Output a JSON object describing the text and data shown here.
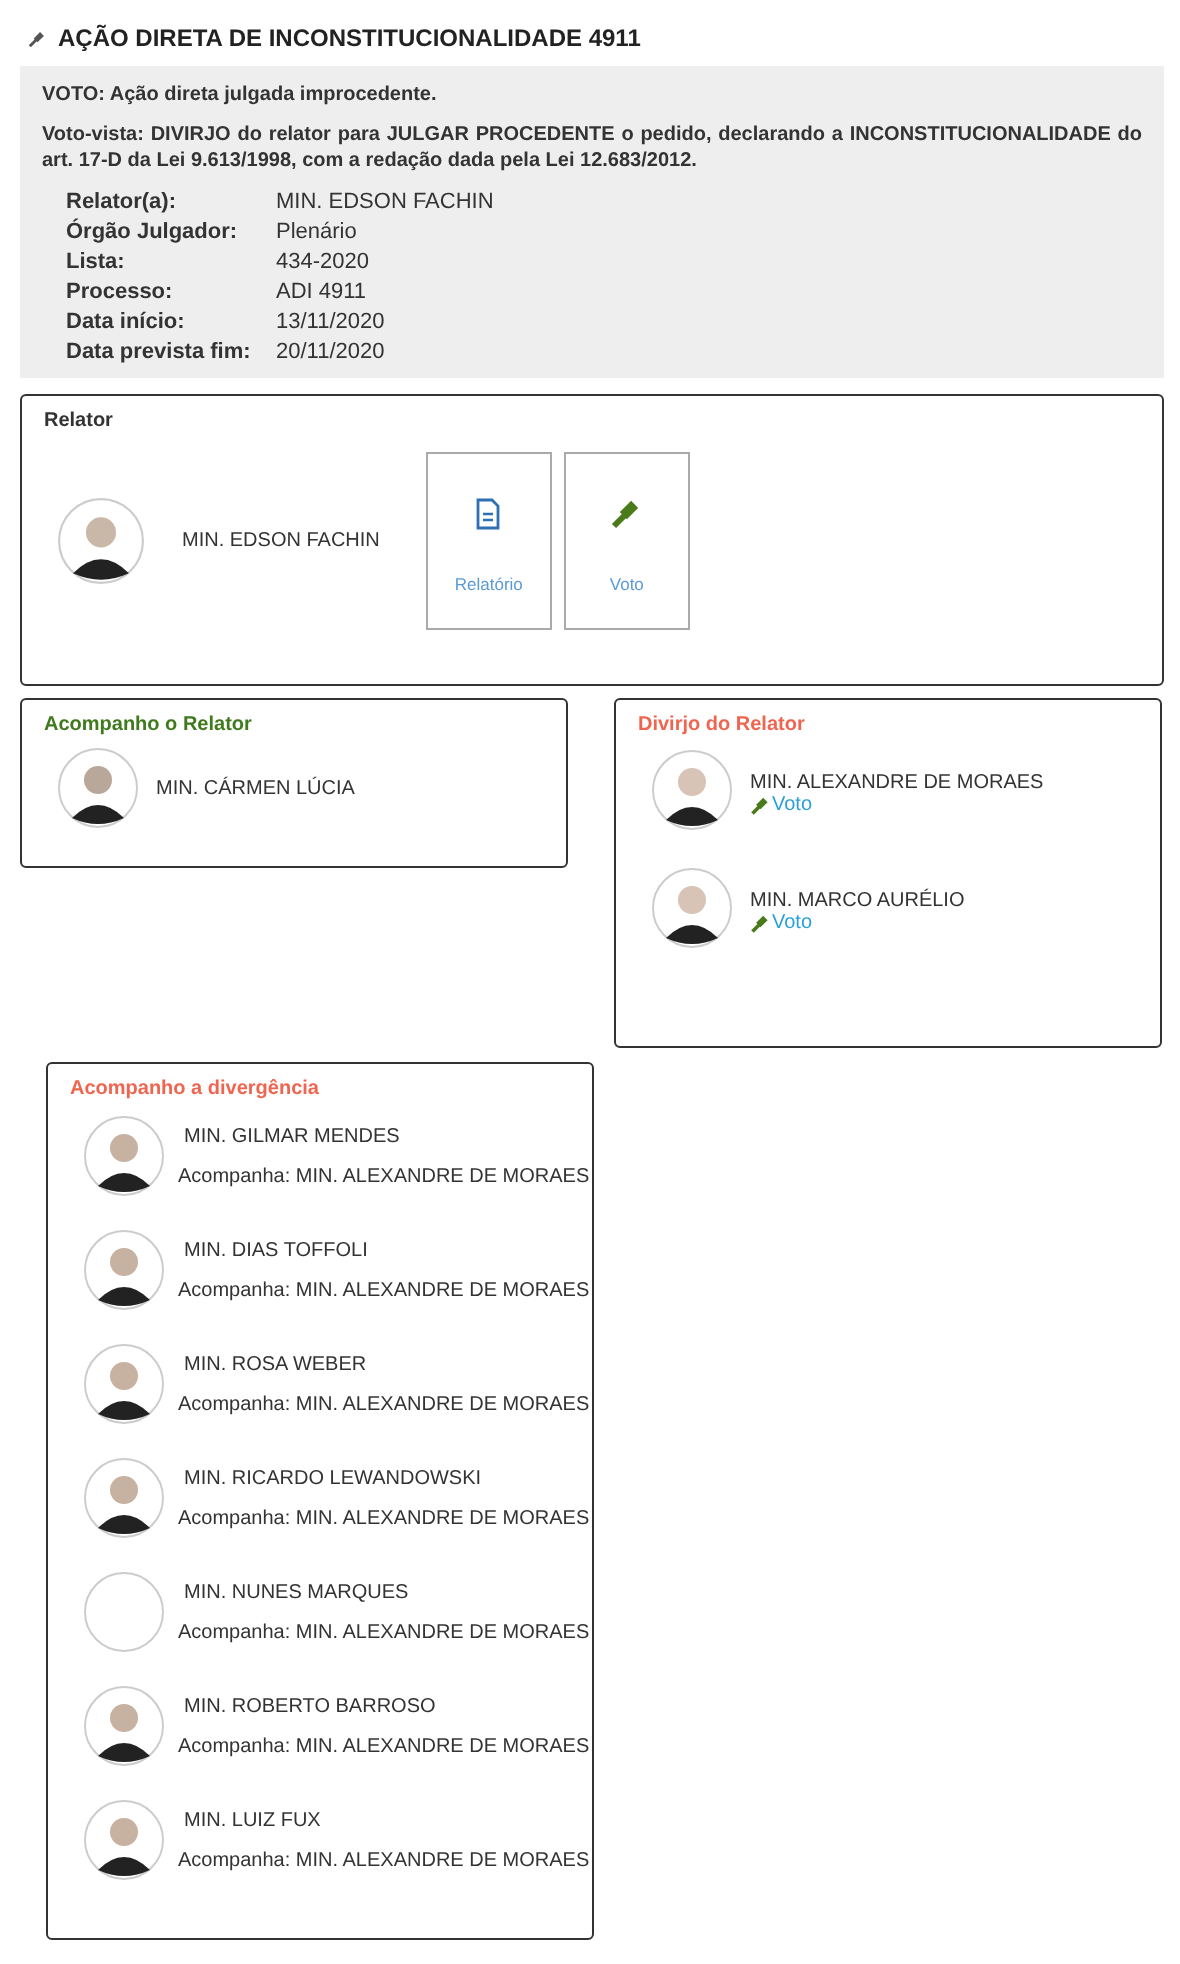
{
  "title": "AÇÃO DIRETA DE INCONSTITUCIONALIDADE 4911",
  "summary": {
    "voto": "VOTO: Ação direta julgada improcedente.",
    "voto_vista": "Voto-vista: DIVIRJO do relator para JULGAR PROCEDENTE o pedido, declarando a INCONSTITUCIONALIDADE do art. 17-D da Lei 9.613/1998, com a redação dada pela Lei 12.683/2012.",
    "fields": [
      {
        "label": "Relator(a):",
        "value": "MIN. EDSON FACHIN"
      },
      {
        "label": "Órgão Julgador:",
        "value": "Plenário"
      },
      {
        "label": "Lista:",
        "value": "434-2020"
      },
      {
        "label": "Processo:",
        "value": "ADI 4911"
      },
      {
        "label": "Data início:",
        "value": "13/11/2020"
      },
      {
        "label": "Data prevista fim:",
        "value": "20/11/2020"
      }
    ]
  },
  "relator": {
    "heading": "Relator",
    "name": "MIN. EDSON FACHIN",
    "buttons": [
      {
        "kind": "document",
        "label": "Relatório"
      },
      {
        "kind": "gavel",
        "label": "Voto"
      }
    ]
  },
  "acompanho": {
    "heading": "Acompanho o Relator",
    "members": [
      {
        "name": "MIN. CÁRMEN LÚCIA"
      }
    ]
  },
  "divirjo": {
    "heading": "Divirjo do Relator",
    "members": [
      {
        "name": "MIN. ALEXANDRE DE MORAES",
        "link": "Voto"
      },
      {
        "name": "MIN. MARCO AURÉLIO",
        "link": "Voto"
      }
    ]
  },
  "divergencia": {
    "heading": "Acompanho a divergência",
    "members": [
      {
        "name": "MIN. GILMAR MENDES",
        "photo": true,
        "follows": "Acompanha: MIN. ALEXANDRE DE MORAES"
      },
      {
        "name": "MIN. DIAS TOFFOLI",
        "photo": true,
        "follows": "Acompanha: MIN. ALEXANDRE DE MORAES"
      },
      {
        "name": "MIN. ROSA WEBER",
        "photo": true,
        "follows": "Acompanha: MIN. ALEXANDRE DE MORAES"
      },
      {
        "name": "MIN. RICARDO LEWANDOWSKI",
        "photo": true,
        "follows": "Acompanha: MIN. ALEXANDRE DE MORAES"
      },
      {
        "name": "MIN. NUNES MARQUES",
        "photo": false,
        "follows": "Acompanha: MIN. ALEXANDRE DE MORAES"
      },
      {
        "name": "MIN. ROBERTO BARROSO",
        "photo": true,
        "follows": "Acompanha: MIN. ALEXANDRE DE MORAES"
      },
      {
        "name": "MIN. LUIZ FUX",
        "photo": true,
        "follows": "Acompanha: MIN. ALEXANDRE DE MORAES"
      }
    ]
  }
}
